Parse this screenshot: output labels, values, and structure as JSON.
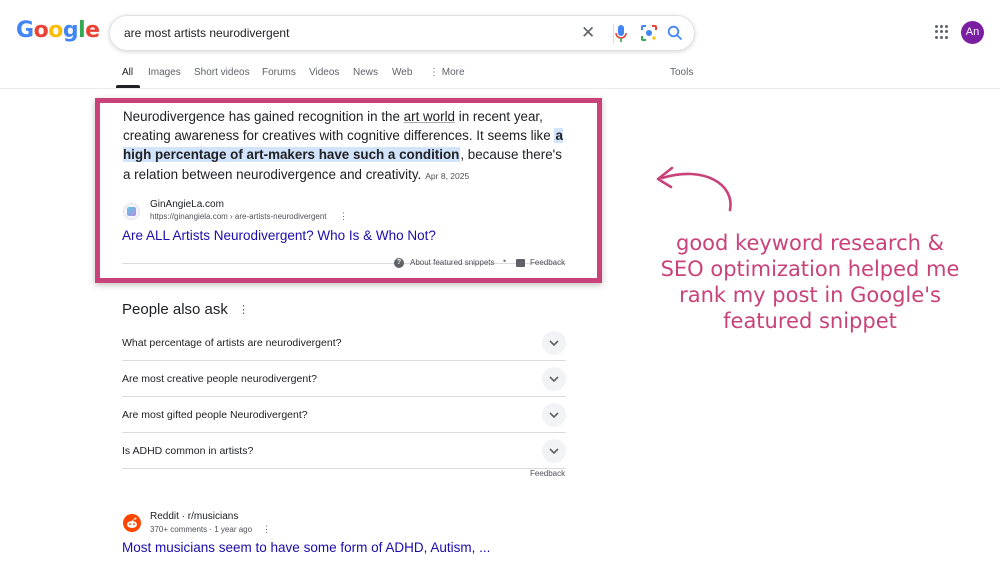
{
  "header": {
    "logo": "Google",
    "search_query": "are most artists neurodivergent",
    "avatar_initials": "An"
  },
  "tabs": [
    {
      "label": "All",
      "active": true
    },
    {
      "label": "Images"
    },
    {
      "label": "Short videos"
    },
    {
      "label": "Forums"
    },
    {
      "label": "Videos"
    },
    {
      "label": "News"
    },
    {
      "label": "Web"
    },
    {
      "label": "More"
    }
  ],
  "tools_label": "Tools",
  "featured_snippet": {
    "text_1": "Neurodivergence has gained recognition in the ",
    "text_link": "art world",
    "text_2": " in recent year, creating awareness for creatives with cognitive differences. It seems like ",
    "highlight": "a high percentage of art-makers have such a condition",
    "text_3": ", because there's a relation between neurodivergence and creativity.",
    "date": "Apr 8, 2025",
    "site_name": "GinAngieLa.com",
    "site_url": "https://ginangiela.com › are-artists-neurodivergent",
    "title": "Are ALL Artists Neurodivergent? Who Is & Who Not?",
    "about_label": "About featured snippets",
    "feedback_label": "Feedback"
  },
  "people_also_ask": {
    "title": "People also ask",
    "questions": [
      "What percentage of artists are neurodivergent?",
      "Are most creative people neurodivergent?",
      "Are most gifted people Neurodivergent?",
      "Is ADHD common in artists?"
    ],
    "feedback_label": "Feedback"
  },
  "reddit_result": {
    "source": "Reddit · r/musicians",
    "meta": "370+ comments · 1 year ago",
    "title": "Most musicians seem to have some form of ADHD, Autism, ..."
  },
  "annotation": {
    "text": "good keyword research & SEO optimization helped me rank my post in Google's featured snippet",
    "color": "#c9427a"
  }
}
